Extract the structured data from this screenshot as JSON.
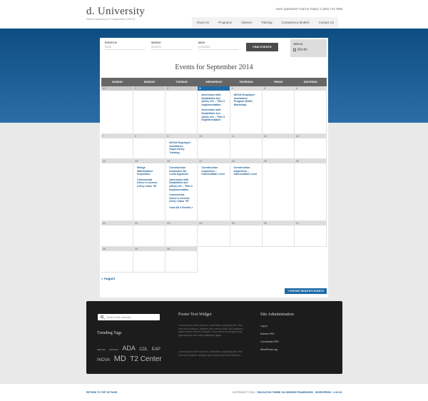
{
  "site": {
    "logo": "d. University",
    "tagline": "District Department of Transportation (DDOT)",
    "phone": "Have Questions? Call Us Today! 1 (202) 741-7665"
  },
  "nav": [
    "About Us",
    "Programs",
    "Classes",
    "Training",
    "Competency Models",
    "Contact Us"
  ],
  "filters": {
    "events_in": {
      "label": "EVENTS IN",
      "placeholder": "Date"
    },
    "search": {
      "label": "SEARCH",
      "placeholder": "Search"
    },
    "near": {
      "label": "NEAR",
      "placeholder": "Location"
    },
    "find_button": "FIND EVENTS",
    "view_as": {
      "label": "VIEW AS",
      "value": "Month"
    }
  },
  "calendar": {
    "title": "Events for September 2014",
    "days": [
      "SUNDAY",
      "MONDAY",
      "TUESDAY",
      "WEDNESDAY",
      "THURSDAY",
      "FRIDAY",
      "SATURDAY"
    ],
    "weeks": [
      [
        {
          "day": "31",
          "past": true,
          "events": []
        },
        {
          "day": "1",
          "past": true,
          "events": []
        },
        {
          "day": "2",
          "past": true,
          "events": []
        },
        {
          "day": "3",
          "today": true,
          "events": [
            "Americans with Disabilities Act (ADA) 101 – Title II Implementation",
            "Americans with Disabilities Act (ADA) 101 – Title II Implementation"
          ]
        },
        {
          "day": "4",
          "events": [
            "INOVA Employee Assistance Program (EAP) Workshop"
          ]
        },
        {
          "day": "5",
          "events": []
        },
        {
          "day": "6",
          "events": []
        }
      ],
      [
        {
          "day": "7",
          "events": []
        },
        {
          "day": "8",
          "events": []
        },
        {
          "day": "9",
          "events": [
            "INOVA Employee Assistance Supervisory Training"
          ]
        },
        {
          "day": "10",
          "events": []
        },
        {
          "day": "11",
          "events": []
        },
        {
          "day": "12",
          "events": []
        },
        {
          "day": "13",
          "events": []
        }
      ],
      [
        {
          "day": "14",
          "events": []
        },
        {
          "day": "15",
          "events": [
            "Bridge Maintenance Inspection",
            "Commercial Driver's License (CDL) Class \"B\""
          ]
        },
        {
          "day": "16",
          "events": [
            "Construction Inspection for Local Agencies",
            "Americans with Disabilities Act (ADA) 101 – Title II Implementation",
            "Commercial Driver's License (CDL) Class \"B\""
          ],
          "view_all": "View All 4 Events »"
        },
        {
          "day": "17",
          "events": [
            "Construction Inspection – Intermediate Level"
          ]
        },
        {
          "day": "18",
          "events": [
            "Construction Inspection – Intermediate Level"
          ]
        },
        {
          "day": "19",
          "events": []
        },
        {
          "day": "20",
          "events": []
        }
      ],
      [
        {
          "day": "21",
          "events": []
        },
        {
          "day": "22",
          "events": []
        },
        {
          "day": "23",
          "events": []
        },
        {
          "day": "24",
          "events": []
        },
        {
          "day": "25",
          "events": []
        },
        {
          "day": "26",
          "events": []
        },
        {
          "day": "27",
          "events": []
        }
      ],
      [
        {
          "day": "28",
          "events": []
        },
        {
          "day": "29",
          "events": []
        },
        {
          "day": "30",
          "events": []
        }
      ]
    ],
    "prev_link": "« August",
    "export_button": "+ EXPORT MONTH'S EVENTS"
  },
  "footer": {
    "search_placeholder": "Search this website…",
    "trending_title": "Trending Tags",
    "tags": [
      {
        "text": "ADA 101",
        "size": 3
      },
      {
        "text": "ADA ACT",
        "size": 3
      },
      {
        "text": "ADA",
        "size": 9
      },
      {
        "text": "CDL",
        "size": 6
      },
      {
        "text": "EAP",
        "size": 6
      },
      {
        "text": "INOVA",
        "size": 6
      },
      {
        "text": "MD",
        "size": 11
      },
      {
        "text": "T2 Center",
        "size": 10
      }
    ],
    "widget_title": "Footer Text Widget",
    "widget_text_1": "Lorem ipsum dolor sit amet, consectetur adipiscing elit. Sed nec lacus tincidunt. Aliquam quis metus turpis. Sed tincidunt, quam laoreet ultrices volutpat, nunc mauris consequat risus, eget dapibus nibh enim adipiscing ligula.",
    "widget_text_2": "Lorem ipsum dolor sit amet, consectetur adipiscing elit. Sed nec lacus facilisis. Aliquam quis metus turpis sed tincidunt.",
    "admin_title": "Site Administration",
    "admin_links": [
      "Log in",
      "Entries RSS",
      "Comments RSS",
      "WordPress.org"
    ]
  },
  "bottom": {
    "return_top": "RETURN TO TOP OF PAGE",
    "copyright_prefix": "COPYRIGHT © 2014 ·",
    "copyright_links": "EDUCATION THEME ON GENESIS FRAMEWORK · WORDPRESS · LOG IN"
  }
}
